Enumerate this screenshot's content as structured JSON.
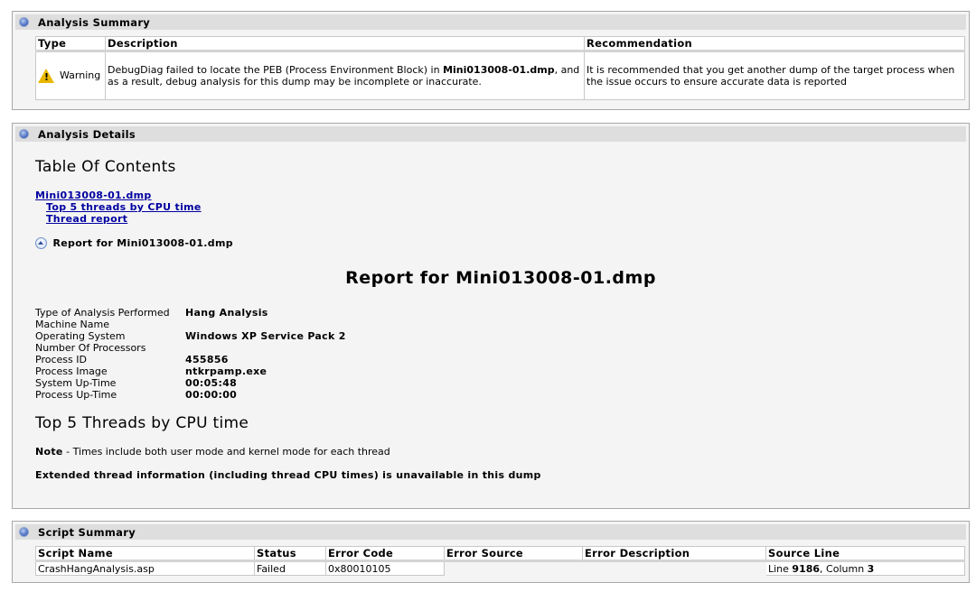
{
  "summary": {
    "title": "Analysis Summary",
    "columns": [
      "Type",
      "Description",
      "Recommendation"
    ],
    "row": {
      "type": "Warning",
      "description_pre": "DebugDiag failed to locate the PEB (Process Environment Block) in ",
      "description_file": "Mini013008-01.dmp",
      "description_post": ", and as a result, debug analysis for this dump may be incomplete or inaccurate.",
      "recommendation": "It is recommended that you get another dump of the target process when the issue occurs to ensure accurate data is reported"
    }
  },
  "details": {
    "title": "Analysis Details",
    "toc_heading": "Table Of Contents",
    "toc": {
      "file_link": "Mini013008-01.dmp",
      "sub_links": [
        "Top 5 threads by CPU time",
        "Thread report"
      ]
    },
    "report_toggle": "Report for Mini013008-01.dmp",
    "report_title": "Report for Mini013008-01.dmp",
    "info": [
      {
        "label": "Type of Analysis Performed",
        "value": "Hang Analysis"
      },
      {
        "label": "Machine Name",
        "value": ""
      },
      {
        "label": "Operating System",
        "value": "Windows XP Service Pack 2"
      },
      {
        "label": "Number Of Processors",
        "value": ""
      },
      {
        "label": "Process ID",
        "value": "455856"
      },
      {
        "label": "Process Image",
        "value": "ntkrpamp.exe"
      },
      {
        "label": "System Up-Time",
        "value": "00:05:48"
      },
      {
        "label": "Process Up-Time",
        "value": "00:00:00"
      }
    ],
    "threads_heading": "Top 5 Threads by CPU time",
    "note_label": "Note",
    "note_text": " - Times include both user mode and kernel mode for each thread",
    "extended_note": "Extended thread information (including thread CPU times) is unavailable in this dump"
  },
  "script": {
    "title": "Script Summary",
    "columns": [
      "Script Name",
      "Status",
      "Error Code",
      "Error Source",
      "Error Description",
      "Source Line"
    ],
    "row": {
      "script_name": "CrashHangAnalysis.asp",
      "status": "Failed",
      "error_code": "0x80010105",
      "error_source": "",
      "error_description": "",
      "line_prefix": "Line ",
      "line_number": "9186",
      "column_prefix": ", Column ",
      "column_number": "3"
    }
  },
  "colors": {
    "link": "#0000a0",
    "panel_background": "#f4f4f4",
    "header_background": "#dedede",
    "warning": "#e8b800"
  },
  "icons": [
    "bullet-icon",
    "warning-icon",
    "collapse-up-icon"
  ]
}
